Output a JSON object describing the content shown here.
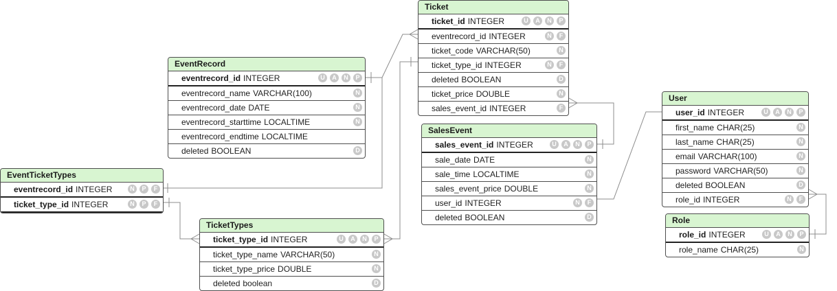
{
  "tables": [
    {
      "id": "ticket",
      "title": "Ticket",
      "columns": [
        {
          "name": "ticket_id",
          "type": "INTEGER",
          "pk": true,
          "badges": [
            "U",
            "A",
            "N",
            "P"
          ]
        },
        {
          "name": "eventrecord_id",
          "type": "INTEGER",
          "badges": [
            "N",
            "F"
          ]
        },
        {
          "name": "ticket_code",
          "type": "VARCHAR(50)",
          "badges": [
            "N"
          ]
        },
        {
          "name": "ticket_type_id",
          "type": "INTEGER",
          "badges": [
            "N",
            "F"
          ]
        },
        {
          "name": "deleted",
          "type": "BOOLEAN",
          "badges": [
            "D"
          ]
        },
        {
          "name": "ticket_price",
          "type": "DOUBLE",
          "badges": [
            "N"
          ]
        },
        {
          "name": "sales_event_id",
          "type": "INTEGER",
          "badges": [
            "F"
          ]
        }
      ]
    },
    {
      "id": "eventrecord",
      "title": "EventRecord",
      "columns": [
        {
          "name": "eventrecord_id",
          "type": "INTEGER",
          "pk": true,
          "badges": [
            "U",
            "A",
            "N",
            "P"
          ]
        },
        {
          "name": "eventrecord_name",
          "type": "VARCHAR(100)",
          "badges": [
            "N"
          ]
        },
        {
          "name": "eventrecord_date",
          "type": "DATE",
          "badges": [
            "N"
          ]
        },
        {
          "name": "eventrecord_starttime",
          "type": "LOCALTIME",
          "badges": [
            "N"
          ]
        },
        {
          "name": "eventrecord_endtime",
          "type": "LOCALTIME",
          "badges": []
        },
        {
          "name": "deleted",
          "type": "BOOLEAN",
          "badges": [
            "D"
          ]
        }
      ]
    },
    {
      "id": "eventtickettypes",
      "title": "EventTicketTypes",
      "columns": [
        {
          "name": "eventrecord_id",
          "type": "INTEGER",
          "pk": true,
          "badges": [
            "N",
            "P",
            "F"
          ]
        },
        {
          "name": "ticket_type_id",
          "type": "INTEGER",
          "pk": true,
          "badges": [
            "N",
            "P",
            "F"
          ]
        }
      ]
    },
    {
      "id": "salesevent",
      "title": "SalesEvent",
      "columns": [
        {
          "name": "sales_event_id",
          "type": "INTEGER",
          "pk": true,
          "badges": [
            "U",
            "A",
            "N",
            "P"
          ]
        },
        {
          "name": "sale_date",
          "type": "DATE",
          "badges": [
            "N"
          ]
        },
        {
          "name": "sale_time",
          "type": "LOCALTIME",
          "badges": [
            "N"
          ]
        },
        {
          "name": "sales_event_price",
          "type": "DOUBLE",
          "badges": [
            "N"
          ]
        },
        {
          "name": "user_id",
          "type": "INTEGER",
          "badges": [
            "N",
            "F"
          ]
        },
        {
          "name": "deleted",
          "type": "BOOLEAN",
          "badges": [
            "D"
          ]
        }
      ]
    },
    {
      "id": "user",
      "title": "User",
      "columns": [
        {
          "name": "user_id",
          "type": "INTEGER",
          "pk": true,
          "badges": [
            "U",
            "A",
            "N",
            "P"
          ]
        },
        {
          "name": "first_name",
          "type": "CHAR(25)",
          "badges": [
            "N"
          ]
        },
        {
          "name": "last_name",
          "type": "CHAR(25)",
          "badges": [
            "N"
          ]
        },
        {
          "name": "email",
          "type": "VARCHAR(100)",
          "badges": [
            "N"
          ]
        },
        {
          "name": "password",
          "type": "VARCHAR(50)",
          "badges": [
            "N"
          ]
        },
        {
          "name": "deleted",
          "type": "BOOLEAN",
          "badges": [
            "D"
          ]
        },
        {
          "name": "role_id",
          "type": "INTEGER",
          "badges": [
            "N",
            "F"
          ]
        }
      ]
    },
    {
      "id": "role",
      "title": "Role",
      "columns": [
        {
          "name": "role_id",
          "type": "INTEGER",
          "pk": true,
          "badges": [
            "U",
            "A",
            "N",
            "P"
          ]
        },
        {
          "name": "role_name",
          "type": "CHAR(25)",
          "badges": [
            "N"
          ]
        }
      ]
    },
    {
      "id": "tickettypes",
      "title": "TicketTypes",
      "columns": [
        {
          "name": "ticket_type_id",
          "type": "INTEGER",
          "pk": true,
          "badges": [
            "U",
            "A",
            "N",
            "P"
          ]
        },
        {
          "name": "ticket_type_name",
          "type": "VARCHAR(50)",
          "badges": [
            "N"
          ]
        },
        {
          "name": "ticket_type_price",
          "type": "DOUBLE",
          "badges": [
            "N"
          ]
        },
        {
          "name": "deleted",
          "type": "boolean",
          "badges": [
            "D"
          ]
        }
      ]
    }
  ],
  "colors": {
    "header_bg": "#d8f5d1",
    "badge_bg": "#c8c8c8",
    "border": "#4d4d4d",
    "edge": "#8c8c8c"
  }
}
